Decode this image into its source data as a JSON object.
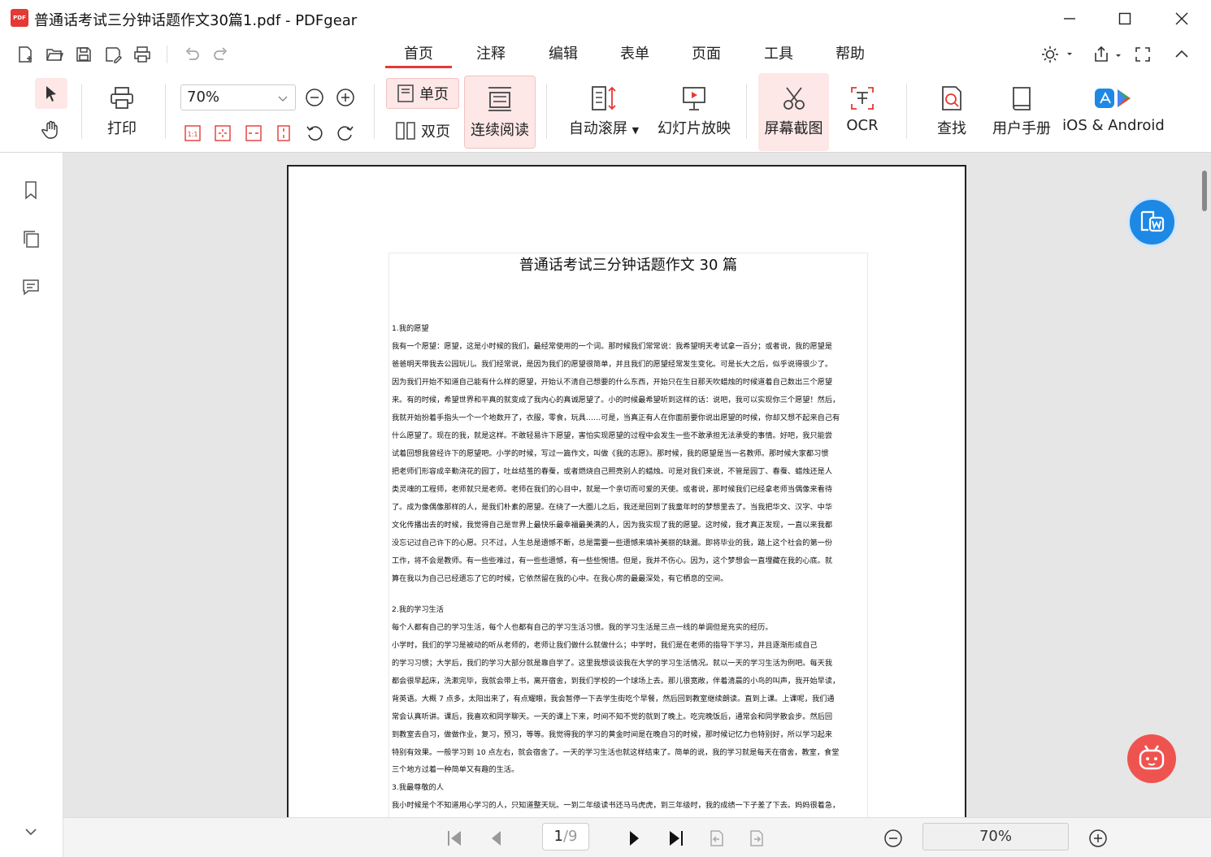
{
  "window": {
    "title": "普通话考试三分钟话题作文30篇1.pdf - PDFgear",
    "logo_text": "PDF"
  },
  "menu_tabs": [
    {
      "label": "首页",
      "active": true
    },
    {
      "label": "注释"
    },
    {
      "label": "编辑"
    },
    {
      "label": "表单"
    },
    {
      "label": "页面"
    },
    {
      "label": "工具"
    },
    {
      "label": "帮助"
    }
  ],
  "ribbon": {
    "print": "打印",
    "zoom_value": "70%",
    "single_page": "单页",
    "double_page": "双页",
    "continuous": "连续阅读",
    "auto_scroll": "自动滚屏",
    "slideshow": "幻灯片放映",
    "screenshot": "屏幕截图",
    "ocr": "OCR",
    "find": "查找",
    "manual": "用户手册",
    "mobile": "iOS & Android",
    "actual_size": "1:1"
  },
  "document": {
    "title": "普通话考试三分钟话题作文 30 篇",
    "lines": [
      "1.我的愿望",
      "我有一个愿望：愿望，这是小时候的我们，最经常使用的一个词。那时候我们常常说：我希望明天考试拿一百分；或者说，我的愿望是",
      "爸爸明天带我去公园玩儿。我们经常说，是因为我们的愿望很简单，并且我们的愿望经常发生变化。可是长大之后，似乎说得很少了。",
      "因为我们开始不知道自己能有什么样的愿望，开始认不清自己想要的什么东西，开始只在生日那天吹蜡烛的时候道着自己数出三个愿望",
      "来。有的时候，希望世界和平真的就变成了我内心的真诚愿望了。小的时候最希望听到这样的话：说吧，我可以实现你三个愿望！然后，",
      "我就开始扮着手指头一个一个地数开了，衣服，零食，玩具……可是，当真正有人在你面前要你说出愿望的时候，你却又想不起来自己有",
      "什么愿望了。现在的我，就是这样。不敢轻易许下愿望，害怕实现愿望的过程中会发生一些不敢承担无法承受的事情。好吧，我只能尝",
      "试着回想我曾经许下的愿望吧。小学的时候，写过一篇作文，叫做《我的志愿》。那时候，我的愿望是当一名教师。那时候大家都习惯",
      "把老师们形容成辛勤浇花的园丁，吐丝结茧的春蚕，或者燃烧自己照亮别人的蜡烛。可是对我们来说，不管是园丁、春蚕、蜡烛还是人",
      "类灵魂的工程师，老师就只是老师。老师在我们的心目中，就是一个亲切而可爱的天使。或者说，那时候我们已经拿老师当偶像来看待",
      "了。成为像偶像那样的人，是我们朴素的愿望。在绕了一大圈儿之后，我还是回到了我童年时的梦想里去了。当我把华文、汉字、中华",
      "文化传播出去的时候，我觉得自己是世界上最快乐最幸福最美满的人，因为我实现了我的愿望。这时候，我才真正发现，一直以来我都",
      "没忘记过自己许下的心愿。只不过，人生总是遗憾不断，总是需要一些遗憾来填补美丽的缺漏。即将毕业的我，踏上这个社会的第一份",
      "工作，将不会是教师。有一些些难过，有一些些遗憾，有一些些惋惜。但是，我并不伤心。因为，这个梦想会一直埋藏在我的心底。就",
      "算在我以为自己已经遗忘了它的时候，它依然留在我的心中。在我心房的最最深处，有它栖息的空间。",
      "2.我的学习生活",
      "每个人都有自己的学习生活，每个人也都有自己的学习生活习惯。我的学习生活是三点一线的单调但是充实的经历。",
      "    小学时，我们的学习是被动的听从老师的，老师让我们做什么就做什么；中学时，我们是在老师的指导下学习，并且逐渐形成自己",
      "的学习习惯；大学后，我们的学习大部分就是靠自学了。这里我想谈谈我在大学的学习生活情况。就以一天的学习生活为例吧。每天我",
      "都会很早起床，洗漱完毕，我就会带上书，离开宿舍，到我们学校的一个球场上去。那儿很宽敞，伴着清晨的小鸟的叫声，我开始早读，",
      "背英语。大概 7 点多，太阳出来了，有点耀眼，我会暂停一下去学生街吃个早餐，然后回到教室继续朗读。直到上课。上课呢，我们通",
      "常会认真听讲。课后，我喜欢和同学聊天。一天的课上下来，时间不知不觉的就到了晚上。吃完晚饭后，通常会和同学散会步。然后回",
      "到教室去自习，做做作业，复习，预习，等等。我觉得我的学习的黄金时间是在晚自习的时候，那时候记忆力也特别好，所以学习起来",
      "特别有效果。一般学习到 10 点左右，就会宿舍了。一天的学习生活也就这样结束了。简单的说，我的学习就是每天在宿舍，教室，食堂",
      "三个地方过着一种简单又有趣的生活。",
      "3.我最尊敬的人",
      "我小时候是个不知道用心学习的人，只知道整天玩。一到二年级读书还马马虎虎，到三年级时，我的成绩一下子差了下去。妈妈很着急，"
    ]
  },
  "pager": {
    "current": "1",
    "total": "/9",
    "zoom": "70%"
  },
  "colors": {
    "accent": "#e53935",
    "translate_fab": "#1e88e5",
    "assistant_fab": "#ef5350"
  }
}
